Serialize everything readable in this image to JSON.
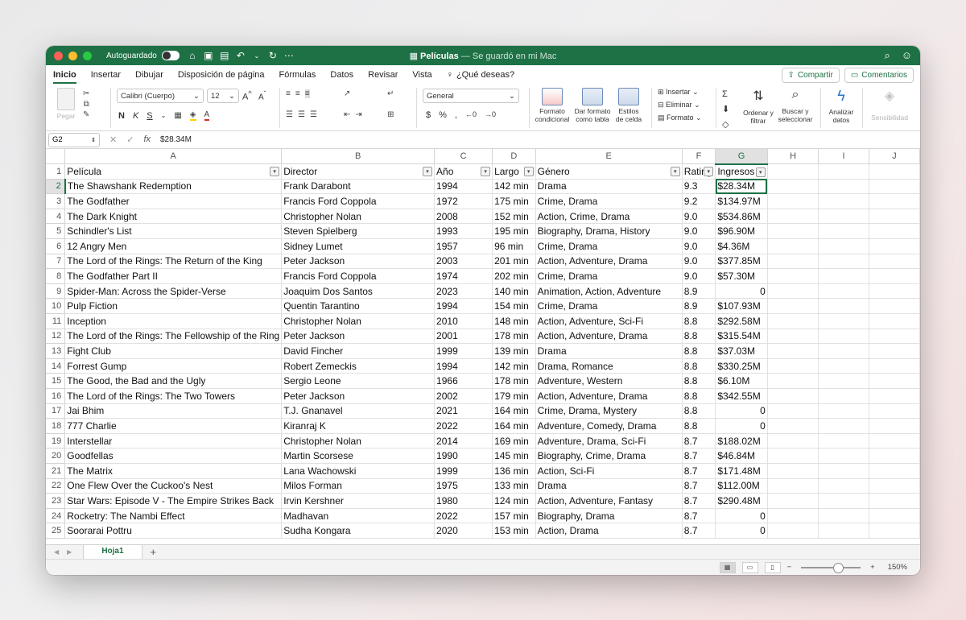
{
  "titlebar": {
    "autosave_label": "Autoguardado",
    "title": "Películas",
    "subtitle": "— Se guardó en mi Mac",
    "accent": "#1e7145"
  },
  "tabs": [
    "Inicio",
    "Insertar",
    "Dibujar",
    "Disposición de página",
    "Fórmulas",
    "Datos",
    "Revisar",
    "Vista"
  ],
  "tell_me": "¿Qué deseas?",
  "share_label": "Compartir",
  "comments_label": "Comentarios",
  "ribbon": {
    "paste_label": "Pegar",
    "font_name": "Calibri (Cuerpo)",
    "font_size": "12",
    "bold": "N",
    "italic": "K",
    "underline": "S",
    "number_format": "General",
    "conditional_format_label": "Formato condicional",
    "format_table_label": "Dar formato como tabla",
    "cell_styles_label": "Estilos de celda",
    "insert_label": "Insertar",
    "delete_label": "Eliminar",
    "format_label": "Formato",
    "sort_filter_label": "Ordenar y filtrar",
    "find_select_label": "Buscar y seleccionar",
    "analyze_label": "Analizar datos",
    "sensitivity_label": "Sensibilidad"
  },
  "formula_bar": {
    "name_box": "G2",
    "fx": "fx",
    "value": "$28.34M"
  },
  "columns": [
    "A",
    "B",
    "C",
    "D",
    "E",
    "F",
    "G",
    "H",
    "I",
    "J"
  ],
  "selected_column": "G",
  "selected_row": 2,
  "header_row": [
    "Película",
    "Director",
    "Año",
    "Largo",
    "Género",
    "Rating",
    "Ingresos"
  ],
  "rows": [
    [
      "The Shawshank Redemption",
      "Frank Darabont",
      "1994",
      "142 min",
      "Drama",
      "9.3",
      "$28.34M"
    ],
    [
      "The Godfather",
      "Francis Ford Coppola",
      "1972",
      "175 min",
      "Crime, Drama",
      "9.2",
      "$134.97M"
    ],
    [
      "The Dark Knight",
      "Christopher Nolan",
      "2008",
      "152 min",
      "Action, Crime, Drama",
      "9.0",
      "$534.86M"
    ],
    [
      "Schindler's List",
      "Steven Spielberg",
      "1993",
      "195 min",
      "Biography, Drama, History",
      "9.0",
      "$96.90M"
    ],
    [
      "12 Angry Men",
      "Sidney Lumet",
      "1957",
      "96 min",
      "Crime, Drama",
      "9.0",
      "$4.36M"
    ],
    [
      "The Lord of the Rings: The Return of the King",
      "Peter Jackson",
      "2003",
      "201 min",
      "Action, Adventure, Drama",
      "9.0",
      "$377.85M"
    ],
    [
      "The Godfather Part II",
      "Francis Ford Coppola",
      "1974",
      "202 min",
      "Crime, Drama",
      "9.0",
      "$57.30M"
    ],
    [
      "Spider-Man: Across the Spider-Verse",
      "Joaquim Dos Santos",
      "2023",
      "140 min",
      "Animation, Action, Adventure",
      "8.9",
      "0"
    ],
    [
      "Pulp Fiction",
      "Quentin Tarantino",
      "1994",
      "154 min",
      "Crime, Drama",
      "8.9",
      "$107.93M"
    ],
    [
      "Inception",
      "Christopher Nolan",
      "2010",
      "148 min",
      "Action, Adventure, Sci-Fi",
      "8.8",
      "$292.58M"
    ],
    [
      "The Lord of the Rings: The Fellowship of the Ring",
      "Peter Jackson",
      "2001",
      "178 min",
      "Action, Adventure, Drama",
      "8.8",
      "$315.54M"
    ],
    [
      "Fight Club",
      "David Fincher",
      "1999",
      "139 min",
      "Drama",
      "8.8",
      "$37.03M"
    ],
    [
      "Forrest Gump",
      "Robert Zemeckis",
      "1994",
      "142 min",
      "Drama, Romance",
      "8.8",
      "$330.25M"
    ],
    [
      "The Good, the Bad and the Ugly",
      "Sergio Leone",
      "1966",
      "178 min",
      "Adventure, Western",
      "8.8",
      "$6.10M"
    ],
    [
      "The Lord of the Rings: The Two Towers",
      "Peter Jackson",
      "2002",
      "179 min",
      "Action, Adventure, Drama",
      "8.8",
      "$342.55M"
    ],
    [
      "Jai Bhim",
      "T.J. Gnanavel",
      "2021",
      "164 min",
      "Crime, Drama, Mystery",
      "8.8",
      "0"
    ],
    [
      "777 Charlie",
      "Kiranraj K",
      "2022",
      "164 min",
      "Adventure, Comedy, Drama",
      "8.8",
      "0"
    ],
    [
      "Interstellar",
      "Christopher Nolan",
      "2014",
      "169 min",
      "Adventure, Drama, Sci-Fi",
      "8.7",
      "$188.02M"
    ],
    [
      "Goodfellas",
      "Martin Scorsese",
      "1990",
      "145 min",
      "Biography, Crime, Drama",
      "8.7",
      "$46.84M"
    ],
    [
      "The Matrix",
      "Lana Wachowski",
      "1999",
      "136 min",
      "Action, Sci-Fi",
      "8.7",
      "$171.48M"
    ],
    [
      "One Flew Over the Cuckoo's Nest",
      "Milos Forman",
      "1975",
      "133 min",
      "Drama",
      "8.7",
      "$112.00M"
    ],
    [
      "Star Wars: Episode V - The Empire Strikes Back",
      "Irvin Kershner",
      "1980",
      "124 min",
      "Action, Adventure, Fantasy",
      "8.7",
      "$290.48M"
    ],
    [
      "Rocketry: The Nambi Effect",
      "Madhavan",
      "2022",
      "157 min",
      "Biography, Drama",
      "8.7",
      "0"
    ],
    [
      "Soorarai Pottru",
      "Sudha Kongara",
      "2020",
      "153 min",
      "Action, Drama",
      "8.7",
      "0"
    ]
  ],
  "sheet_tab": "Hoja1",
  "zoom": "150%"
}
